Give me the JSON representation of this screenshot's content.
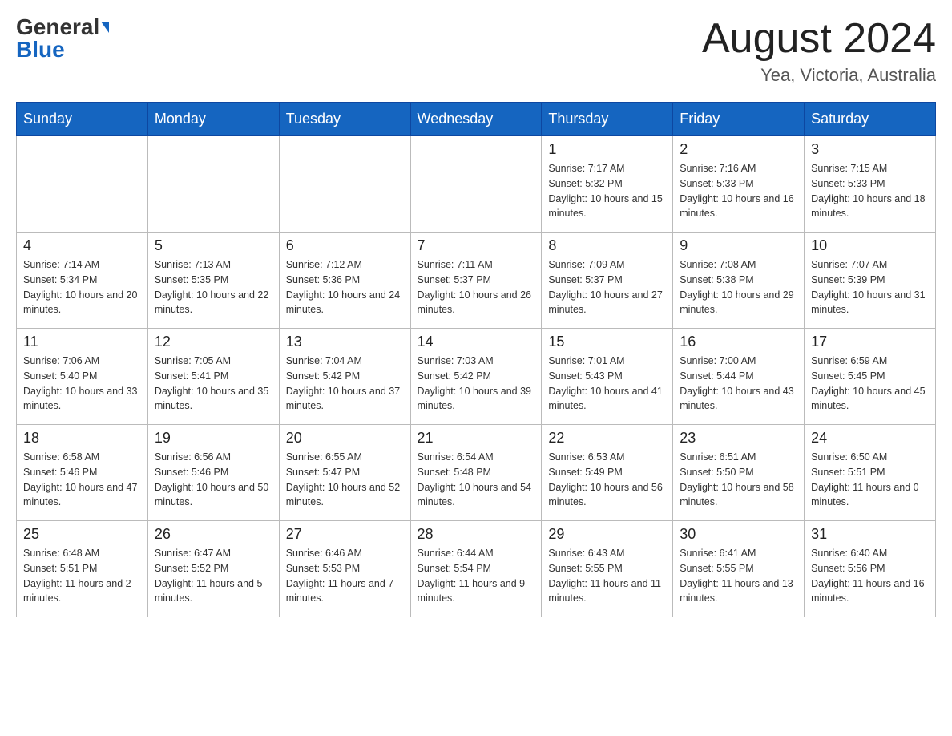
{
  "header": {
    "logo": {
      "general": "General",
      "blue": "Blue"
    },
    "title": "August 2024",
    "location": "Yea, Victoria, Australia"
  },
  "calendar": {
    "days_of_week": [
      "Sunday",
      "Monday",
      "Tuesday",
      "Wednesday",
      "Thursday",
      "Friday",
      "Saturday"
    ],
    "weeks": [
      [
        {
          "day": "",
          "info": ""
        },
        {
          "day": "",
          "info": ""
        },
        {
          "day": "",
          "info": ""
        },
        {
          "day": "",
          "info": ""
        },
        {
          "day": "1",
          "info": "Sunrise: 7:17 AM\nSunset: 5:32 PM\nDaylight: 10 hours and 15 minutes."
        },
        {
          "day": "2",
          "info": "Sunrise: 7:16 AM\nSunset: 5:33 PM\nDaylight: 10 hours and 16 minutes."
        },
        {
          "day": "3",
          "info": "Sunrise: 7:15 AM\nSunset: 5:33 PM\nDaylight: 10 hours and 18 minutes."
        }
      ],
      [
        {
          "day": "4",
          "info": "Sunrise: 7:14 AM\nSunset: 5:34 PM\nDaylight: 10 hours and 20 minutes."
        },
        {
          "day": "5",
          "info": "Sunrise: 7:13 AM\nSunset: 5:35 PM\nDaylight: 10 hours and 22 minutes."
        },
        {
          "day": "6",
          "info": "Sunrise: 7:12 AM\nSunset: 5:36 PM\nDaylight: 10 hours and 24 minutes."
        },
        {
          "day": "7",
          "info": "Sunrise: 7:11 AM\nSunset: 5:37 PM\nDaylight: 10 hours and 26 minutes."
        },
        {
          "day": "8",
          "info": "Sunrise: 7:09 AM\nSunset: 5:37 PM\nDaylight: 10 hours and 27 minutes."
        },
        {
          "day": "9",
          "info": "Sunrise: 7:08 AM\nSunset: 5:38 PM\nDaylight: 10 hours and 29 minutes."
        },
        {
          "day": "10",
          "info": "Sunrise: 7:07 AM\nSunset: 5:39 PM\nDaylight: 10 hours and 31 minutes."
        }
      ],
      [
        {
          "day": "11",
          "info": "Sunrise: 7:06 AM\nSunset: 5:40 PM\nDaylight: 10 hours and 33 minutes."
        },
        {
          "day": "12",
          "info": "Sunrise: 7:05 AM\nSunset: 5:41 PM\nDaylight: 10 hours and 35 minutes."
        },
        {
          "day": "13",
          "info": "Sunrise: 7:04 AM\nSunset: 5:42 PM\nDaylight: 10 hours and 37 minutes."
        },
        {
          "day": "14",
          "info": "Sunrise: 7:03 AM\nSunset: 5:42 PM\nDaylight: 10 hours and 39 minutes."
        },
        {
          "day": "15",
          "info": "Sunrise: 7:01 AM\nSunset: 5:43 PM\nDaylight: 10 hours and 41 minutes."
        },
        {
          "day": "16",
          "info": "Sunrise: 7:00 AM\nSunset: 5:44 PM\nDaylight: 10 hours and 43 minutes."
        },
        {
          "day": "17",
          "info": "Sunrise: 6:59 AM\nSunset: 5:45 PM\nDaylight: 10 hours and 45 minutes."
        }
      ],
      [
        {
          "day": "18",
          "info": "Sunrise: 6:58 AM\nSunset: 5:46 PM\nDaylight: 10 hours and 47 minutes."
        },
        {
          "day": "19",
          "info": "Sunrise: 6:56 AM\nSunset: 5:46 PM\nDaylight: 10 hours and 50 minutes."
        },
        {
          "day": "20",
          "info": "Sunrise: 6:55 AM\nSunset: 5:47 PM\nDaylight: 10 hours and 52 minutes."
        },
        {
          "day": "21",
          "info": "Sunrise: 6:54 AM\nSunset: 5:48 PM\nDaylight: 10 hours and 54 minutes."
        },
        {
          "day": "22",
          "info": "Sunrise: 6:53 AM\nSunset: 5:49 PM\nDaylight: 10 hours and 56 minutes."
        },
        {
          "day": "23",
          "info": "Sunrise: 6:51 AM\nSunset: 5:50 PM\nDaylight: 10 hours and 58 minutes."
        },
        {
          "day": "24",
          "info": "Sunrise: 6:50 AM\nSunset: 5:51 PM\nDaylight: 11 hours and 0 minutes."
        }
      ],
      [
        {
          "day": "25",
          "info": "Sunrise: 6:48 AM\nSunset: 5:51 PM\nDaylight: 11 hours and 2 minutes."
        },
        {
          "day": "26",
          "info": "Sunrise: 6:47 AM\nSunset: 5:52 PM\nDaylight: 11 hours and 5 minutes."
        },
        {
          "day": "27",
          "info": "Sunrise: 6:46 AM\nSunset: 5:53 PM\nDaylight: 11 hours and 7 minutes."
        },
        {
          "day": "28",
          "info": "Sunrise: 6:44 AM\nSunset: 5:54 PM\nDaylight: 11 hours and 9 minutes."
        },
        {
          "day": "29",
          "info": "Sunrise: 6:43 AM\nSunset: 5:55 PM\nDaylight: 11 hours and 11 minutes."
        },
        {
          "day": "30",
          "info": "Sunrise: 6:41 AM\nSunset: 5:55 PM\nDaylight: 11 hours and 13 minutes."
        },
        {
          "day": "31",
          "info": "Sunrise: 6:40 AM\nSunset: 5:56 PM\nDaylight: 11 hours and 16 minutes."
        }
      ]
    ]
  }
}
